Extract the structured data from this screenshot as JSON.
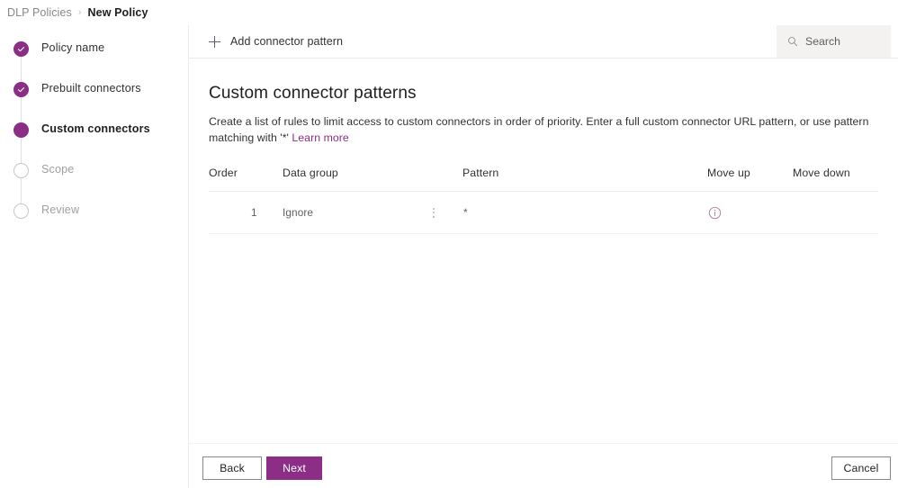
{
  "breadcrumb": {
    "root": "DLP Policies",
    "separator": "›",
    "current": "New Policy"
  },
  "wizard": {
    "steps": [
      {
        "label": "Policy name",
        "state": "completed",
        "icon": "check-circle-icon"
      },
      {
        "label": "Prebuilt connectors",
        "state": "completed",
        "icon": "check-circle-icon"
      },
      {
        "label": "Custom connectors",
        "state": "current",
        "icon": "filled-circle-icon"
      },
      {
        "label": "Scope",
        "state": "upcoming",
        "icon": "empty-circle-icon"
      },
      {
        "label": "Review",
        "state": "upcoming",
        "icon": "empty-circle-icon"
      }
    ]
  },
  "commandbar": {
    "add_label": "Add connector pattern",
    "add_icon": "plus-icon",
    "search_icon": "search-icon",
    "search_placeholder": "Search",
    "search_value": ""
  },
  "main": {
    "title": "Custom connector patterns",
    "description_before": "Create a list of rules to limit access to custom connectors in order of priority. Enter a full custom connector URL pattern, or use pattern matching with '*' ",
    "link_text": "Learn more"
  },
  "table": {
    "columns": [
      "Order",
      "Data group",
      "Pattern",
      "Move up",
      "Move down"
    ],
    "rows": [
      {
        "order": "1",
        "data_group": "Ignore",
        "data_group_menu_icon": "more-vertical-icon",
        "pattern": "*",
        "move_up_icon": "info-circle-icon",
        "move_down": ""
      }
    ]
  },
  "footer": {
    "back_label": "Back",
    "next_label": "Next",
    "cancel_label": "Cancel"
  },
  "colors": {
    "accent": "#8c2d86",
    "link": "#8c2d86",
    "search_background": "#f3f2f1",
    "divider": "#edebe9",
    "text": "#323130",
    "muted_text": "#a19f9d"
  }
}
